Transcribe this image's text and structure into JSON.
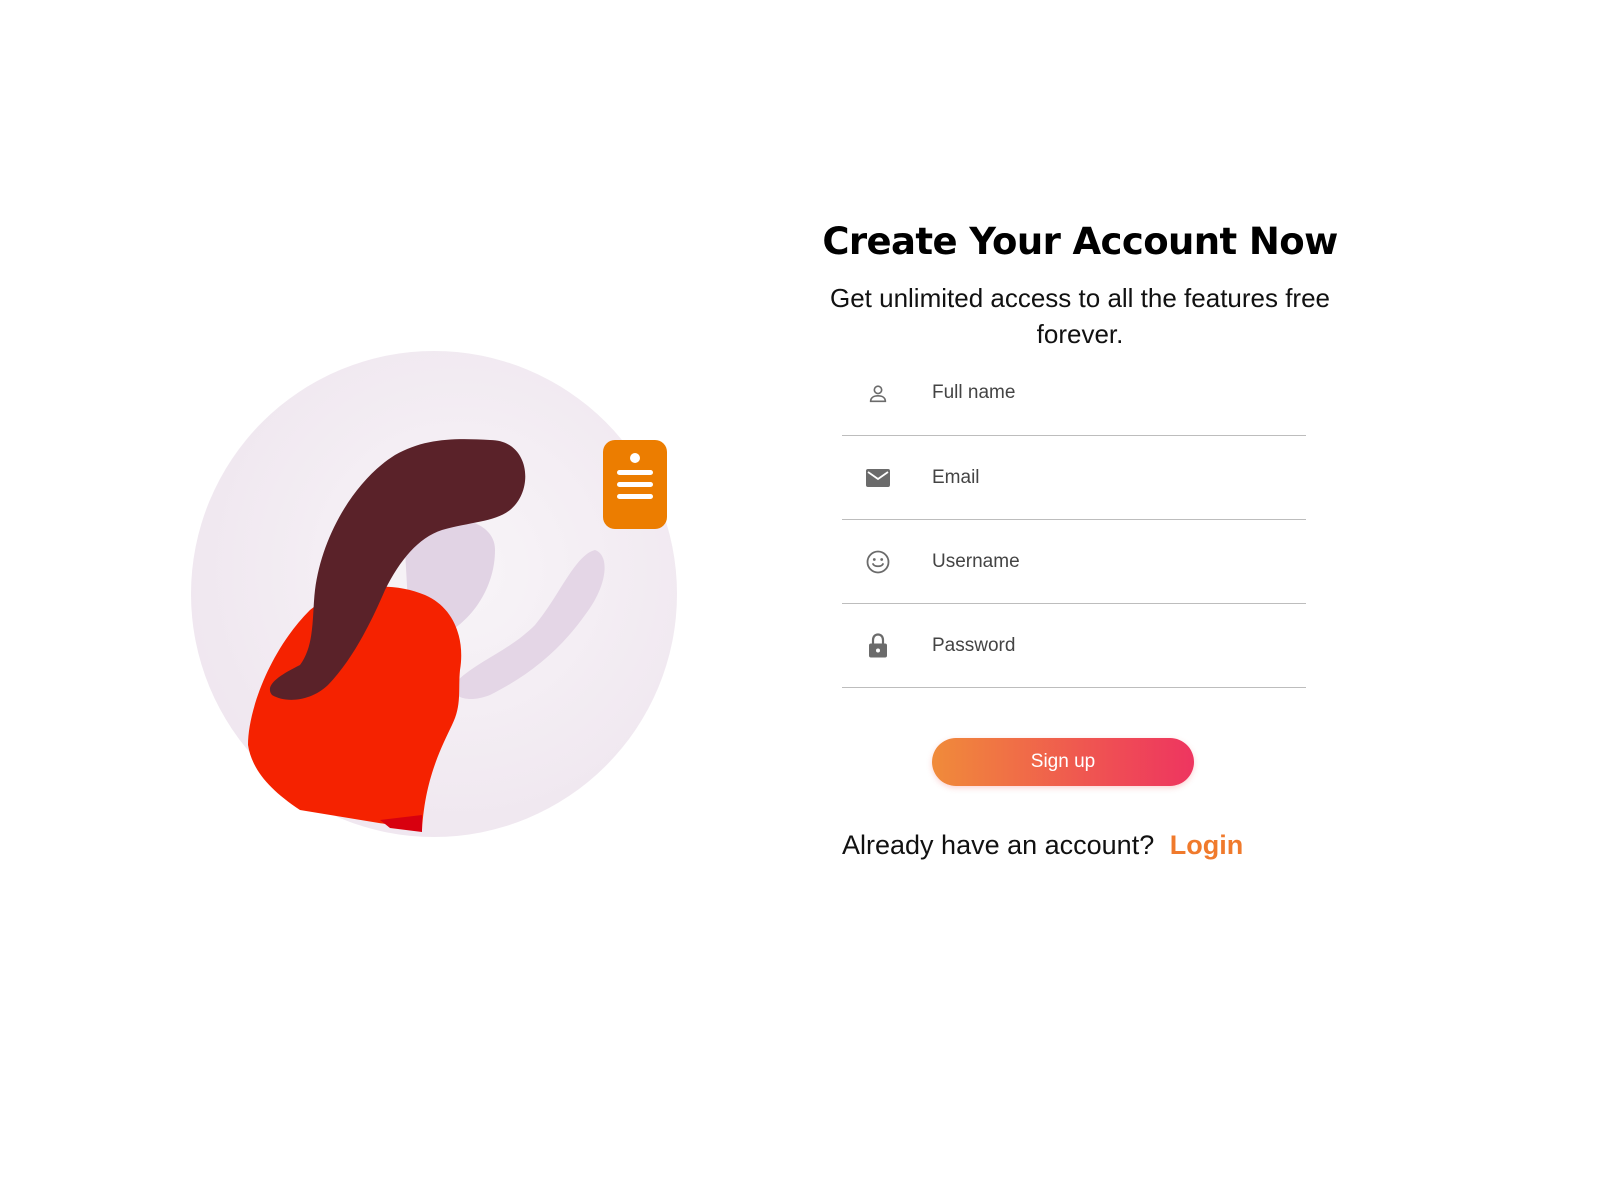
{
  "header": {
    "title": "Create Your Account Now",
    "subtitle": "Get unlimited access to all the features free forever."
  },
  "form": {
    "fields": [
      {
        "icon": "person-icon",
        "placeholder": "Full name",
        "value": ""
      },
      {
        "icon": "email-icon",
        "placeholder": "Email",
        "value": ""
      },
      {
        "icon": "smiley-icon",
        "placeholder": "Username",
        "value": ""
      },
      {
        "icon": "lock-icon",
        "placeholder": "Password",
        "value": ""
      }
    ],
    "submit_label": "Sign up"
  },
  "footer": {
    "prompt": "Already have an account?",
    "login_label": "Login"
  },
  "colors": {
    "accent": "#f07a2c",
    "button_gradient_start": "#f08b3a",
    "button_gradient_end": "#ee3560",
    "illustration_circle": "#f4eef3",
    "hair": "#5a2229",
    "shirt": "#f52200",
    "badge": "#ec7d00"
  },
  "illustration": {
    "subject": "woman-waving-illustration",
    "badge_icon": "id-badge-icon"
  }
}
